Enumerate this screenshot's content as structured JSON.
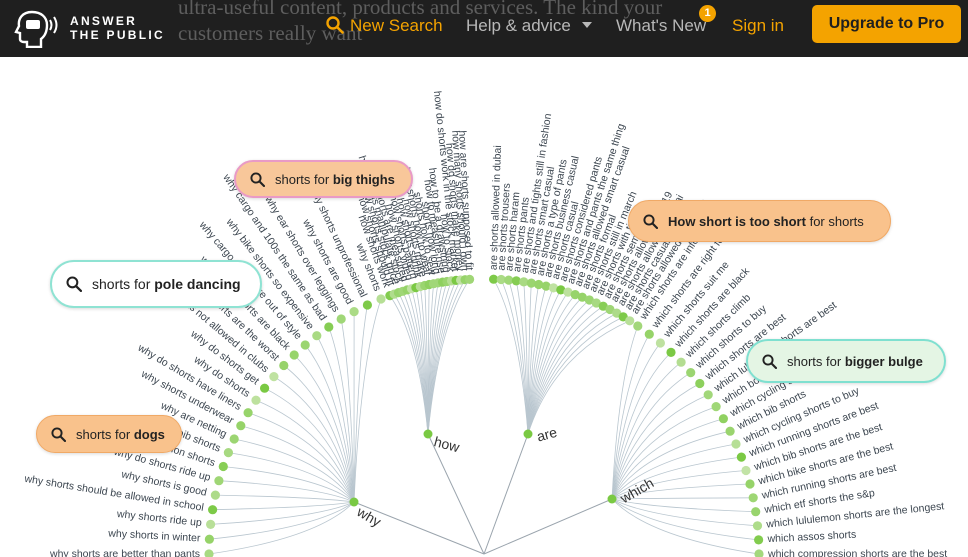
{
  "header": {
    "background_text": "ultra-useful content, products and services. The kind your customers really want",
    "logo": {
      "line1": "ANSWER",
      "line2": "THE PUBLIC"
    },
    "nav": {
      "new_search": "New Search",
      "help": "Help & advice",
      "whats_new": "What's New",
      "whats_new_badge": "1",
      "sign_in": "Sign in",
      "upgrade": "Upgrade to Pro"
    }
  },
  "visualization": {
    "center_color": "#7ac943",
    "branches": [
      {
        "label": "why",
        "leaves": [
          "why shorts are better than pants",
          "why shorts in winter",
          "why shorts ride up",
          "why shorts should be allowed in school",
          "why shorts is good",
          "why do shorts ride up",
          "why compression shorts",
          "why bib shorts",
          "why are netting",
          "why shorts underwear",
          "why do shorts have liners",
          "why do shorts",
          "why do shorts get",
          "why are shorts not allowed in clubs",
          "why bike shorts are the worst",
          "why cargo shorts are black",
          "why cargo shorts are out of style",
          "why bike shorts so expensive",
          "why cargo and 100s the same as bad",
          "why ear shorts over leggings",
          "why shorts are good",
          "why shorts unprofessional",
          "why shorts"
        ]
      },
      {
        "label": "how",
        "leaves": [
          "how shorts work",
          "how shorts should fit",
          "how shorts stock price",
          "how shorts manipulate stock",
          "how shorts are measured",
          "how shorts video",
          "how shorts pattern",
          "how shorts shrink",
          "how shorts make",
          "how shorts how to wear",
          "shorts how to sew",
          "shorts how long",
          "how to measure rise",
          "how to be a drawstring",
          "how to stock",
          "how do shorts work in the stock market",
          "how do shorts make money",
          "how many shorts should i own",
          "how are shorts supposed to fit"
        ]
      },
      {
        "label": "are",
        "leaves": [
          "are shorts allowed in dubai",
          "are shorts trousers",
          "are shorts haram",
          "are shorts pants",
          "are shorts and tights still in fashion",
          "are shorts smart casual",
          "are shorts a type of pants",
          "are shorts business casual",
          "are shorts casual",
          "are shorts considered pants",
          "are shorts and pants the same thing",
          "are shorts allowed smart casual",
          "are shorts formal",
          "are shorts still in march",
          "are shorts with tights",
          "are shorts semi formal",
          "are shorts allowed in 2019",
          "are shorts allowed in dubai",
          "are shorts casual attire",
          "are shorts allowed in angkas"
        ]
      },
      {
        "label": "which",
        "leaves": [
          "which shorts are informed",
          "which shorts are right for me",
          "which shorts suit me",
          "which shorts are black",
          "which shorts climb",
          "which shorts to buy",
          "which shorts are best",
          "which lululemon shorts are best",
          "which boxer shorts are",
          "which cycling shorts",
          "which bib shorts",
          "which cycling shorts to buy",
          "which running shorts are best",
          "which bib shorts are the best",
          "which bike shorts are the best",
          "which running shorts are best",
          "which etf shorts the s&p",
          "which lululemon shorts are the longest",
          "which assos shorts",
          "which compression shorts are the best"
        ]
      }
    ]
  },
  "pills": {
    "big_thighs": {
      "prefix": "shorts for",
      "keyword": "big thighs"
    },
    "pole_dancing": {
      "prefix": "shorts for",
      "keyword": "pole dancing"
    },
    "dogs": {
      "prefix": "shorts for",
      "keyword": "dogs"
    },
    "how_short": {
      "prefix": "for shorts",
      "keyword": "How short is too short"
    },
    "bigger_bulge": {
      "prefix": "shorts for",
      "keyword": "bigger bulge"
    }
  }
}
